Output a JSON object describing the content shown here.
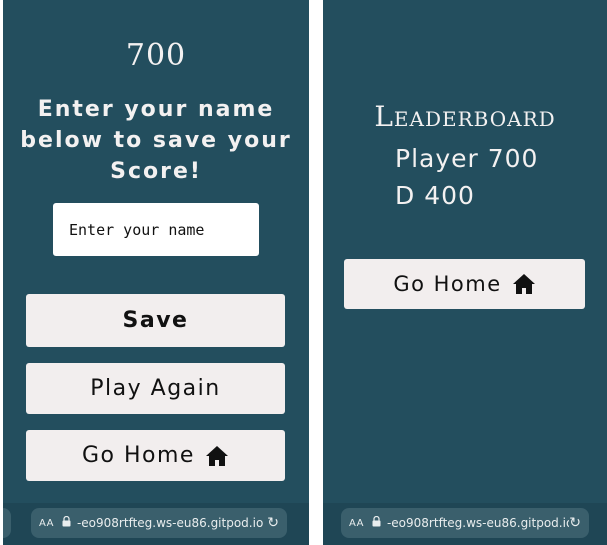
{
  "left_screen": {
    "score": "700",
    "prompt": "Enter your name below to save your Score!",
    "name_input": {
      "placeholder": "Enter your name",
      "value": ""
    },
    "buttons": {
      "save": "Save",
      "play_again": "Play Again",
      "go_home": "Go Home"
    },
    "url": "-eo908rtfteg.ws-eu86.gitpod.io"
  },
  "right_screen": {
    "title": "Leaderboard",
    "entries": [
      {
        "name": "Player",
        "score": "700"
      },
      {
        "name": "D",
        "score": "400"
      }
    ],
    "buttons": {
      "go_home": "Go Home"
    },
    "url": "-eo908rtfteg.ws-eu86.gitpod.io"
  },
  "browser": {
    "text_size_label": "AA",
    "icons": [
      "lock-icon",
      "reload-icon"
    ]
  },
  "colors": {
    "background": "#234e5e",
    "button": "#f2eeee",
    "text_light": "#f3f1f1"
  }
}
